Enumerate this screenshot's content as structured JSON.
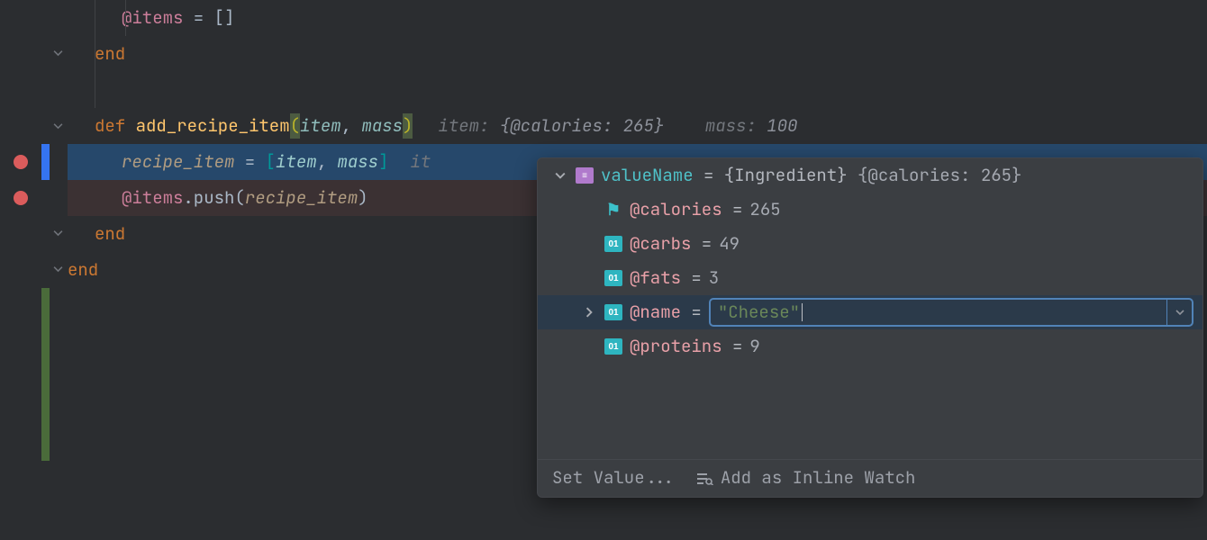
{
  "code": {
    "l1_ivar": "@items",
    "l1_rest": " = []",
    "l2": "end",
    "l3_def": "def",
    "l3_name": " add_recipe_item",
    "l3_p1": "item",
    "l3_sep": ", ",
    "l3_p2": "mass",
    "hint3_item_label": "item:",
    "hint3_item_val": " {@calories: 265}",
    "hint3_mass_label": "mass:",
    "hint3_mass_val": " 100",
    "l4_local": "recipe_item",
    "l4_mid": " = ",
    "l4_p1": "item",
    "l4_sep": ", ",
    "l4_p2": "mass",
    "hint4_partial": "it",
    "l5_ivar": "@items",
    "l5_mid": ".push(",
    "l5_arg": "recipe_item",
    "l5_close": ")",
    "l6": "end",
    "l7": "end"
  },
  "popup": {
    "head_left": "valueName",
    "head_mid": " = {Ingredient} ",
    "head_right": "{@calories: 265}",
    "rows": [
      {
        "icon": "flag",
        "name": "@calories",
        "val": "265"
      },
      {
        "icon": "01",
        "name": "@carbs",
        "val": "49"
      },
      {
        "icon": "01",
        "name": "@fats",
        "val": "3"
      },
      {
        "icon": "01",
        "name": "@name",
        "val": "\"Cheese\"",
        "edit": true
      },
      {
        "icon": "01",
        "name": "@proteins",
        "val": "9"
      }
    ],
    "footer_set": "Set Value...",
    "footer_add": "Add as Inline Watch"
  }
}
